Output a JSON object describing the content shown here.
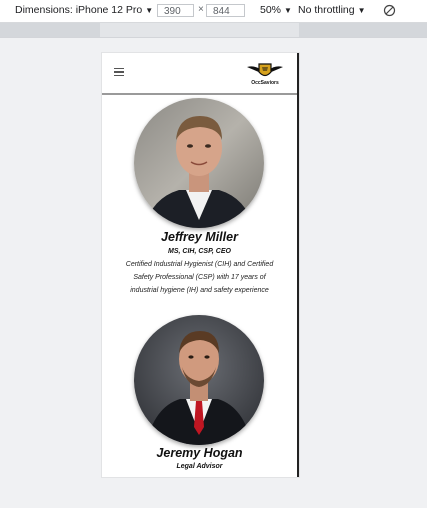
{
  "devtools": {
    "dimensions_label": "Dimensions: iPhone 12 Pro",
    "width_value": "390",
    "times_symbol": "×",
    "height_value": "844",
    "zoom_label": "50%",
    "throttling_label": "No throttling",
    "dropdown_icon": "triangle-down-icon",
    "rotate_icon": "rotate-icon"
  },
  "site": {
    "logo_text": "OccSaviors"
  },
  "team": [
    {
      "name": "Jeffrey Miller",
      "credentials": "MS, CIH, CSP, CEO",
      "bio_lines": [
        "Certified Industrial Hygienist (CIH) and Certified",
        "Safety Professional (CSP) with 17 years of",
        "industrial hygiene (IH) and safety experience"
      ]
    },
    {
      "name": "Jeremy Hogan",
      "credentials": "Legal Advisor"
    }
  ]
}
